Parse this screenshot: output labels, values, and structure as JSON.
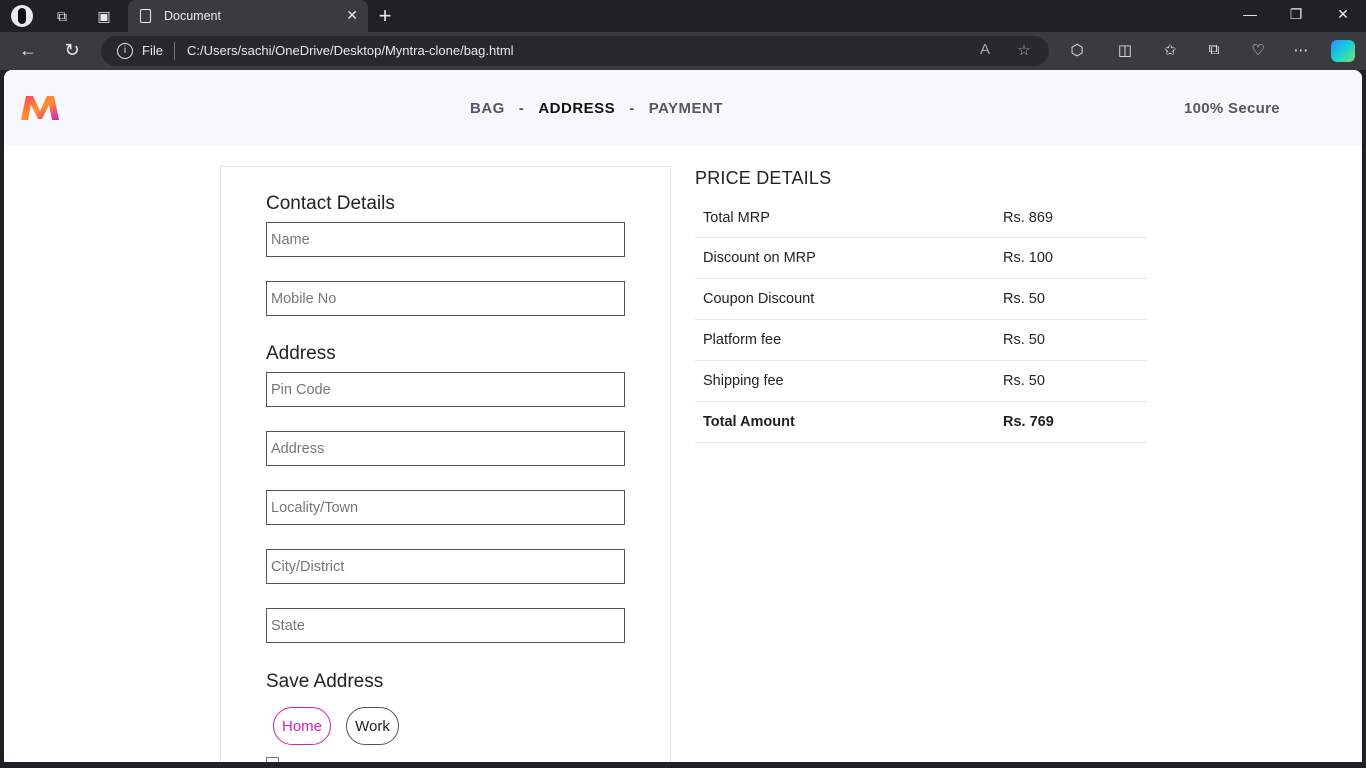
{
  "browser": {
    "tab_title": "Document",
    "file_label": "File",
    "url": "C:/Users/sachi/OneDrive/Desktop/Myntra-clone/bag.html"
  },
  "header": {
    "steps": [
      "BAG",
      "ADDRESS",
      "PAYMENT"
    ],
    "step_separator": "-",
    "active_step": "ADDRESS",
    "secure_label": "100% Secure"
  },
  "form": {
    "contact_title": "Contact Details",
    "name_placeholder": "Name",
    "mobile_placeholder": "Mobile No",
    "address_title": "Address",
    "pincode_placeholder": "Pin Code",
    "address_placeholder": "Address",
    "locality_placeholder": "Locality/Town",
    "city_placeholder": "City/District",
    "state_placeholder": "State",
    "save_title": "Save Address",
    "home_label": "Home",
    "work_label": "Work"
  },
  "price": {
    "title": "PRICE DETAILS",
    "rows": [
      {
        "label": "Total MRP",
        "value": "Rs. 869"
      },
      {
        "label": "Discount on MRP",
        "value": "Rs. 100"
      },
      {
        "label": "Coupon Discount",
        "value": "Rs. 50"
      },
      {
        "label": "Platform fee",
        "value": "Rs. 50"
      },
      {
        "label": "Shipping fee",
        "value": "Rs. 50"
      }
    ],
    "total_label": "Total Amount",
    "total_value": "Rs. 769"
  },
  "colors": {
    "accent": "#d21fbd",
    "logo_gradient": [
      "#ff3f6c",
      "#ff9329",
      "#d21fbd"
    ]
  }
}
